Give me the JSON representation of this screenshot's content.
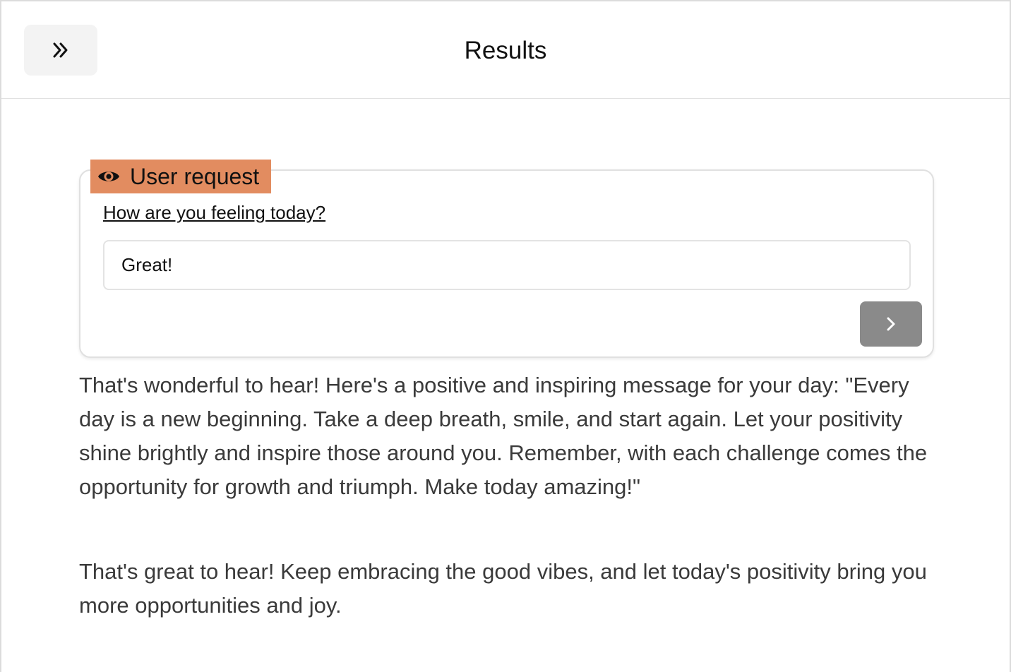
{
  "header": {
    "title": "Results",
    "toggle_icon": "double-chevron-right-icon"
  },
  "request_card": {
    "badge_label": "User request",
    "badge_icon": "eye-icon",
    "badge_color": "#e28c60",
    "question": "How are you feeling today?",
    "answer_value": "Great!",
    "answer_placeholder": "",
    "submit_icon": "chevron-right-icon",
    "submit_color": "#8a8a8a"
  },
  "responses": [
    "That's wonderful to hear! Here's a positive and inspiring message for your day: \"Every day is a new beginning. Take a deep breath, smile, and start again. Let your positivity shine brightly and inspire those around you. Remember, with each challenge comes the opportunity for growth and triumph. Make today amazing!\"",
    "That's great to hear! Keep embracing the good vibes, and let today's positivity bring you more opportunities and joy."
  ]
}
